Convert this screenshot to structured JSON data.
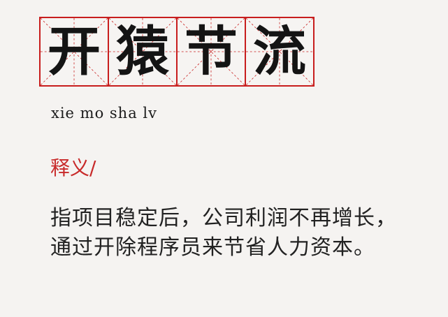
{
  "title_characters": [
    "开",
    "猿",
    "节",
    "流"
  ],
  "pinyin": "xie mo sha lv",
  "section_heading": "释义/",
  "definition": "指项目稳定后，公司利润不再增长，通过开除程序员来节省人力资本。",
  "colors": {
    "grid_red": "#c81d1d",
    "heading_red": "#c82a2a",
    "text": "#222222",
    "background": "#f5f3f1"
  }
}
